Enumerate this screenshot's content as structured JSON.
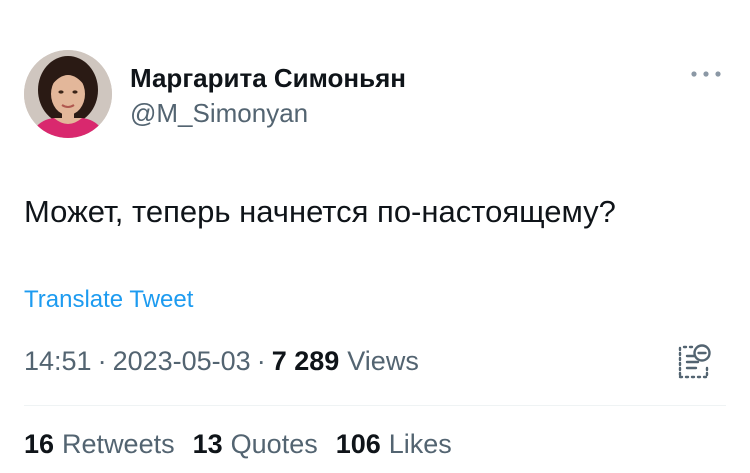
{
  "author": {
    "name": "Маргарита Симоньян",
    "handle": "@M_Simonyan"
  },
  "tweet": {
    "text": "Может, теперь начнется по-настоящему?",
    "translate_label": "Translate Tweet"
  },
  "meta": {
    "time": "14:51",
    "separator": "·",
    "date": "2023-05-03",
    "views_count": "7 289",
    "views_label": "Views"
  },
  "stats": {
    "retweets_count": "16",
    "retweets_label": "Retweets",
    "quotes_count": "13",
    "quotes_label": "Quotes",
    "likes_count": "106",
    "likes_label": "Likes"
  },
  "icons": {
    "more": "more-dots-icon",
    "analytics": "analytics-icon"
  },
  "colors": {
    "text": "#0f1419",
    "secondary": "#536471",
    "link": "#1d9bf0",
    "divider": "#eff3f4"
  }
}
